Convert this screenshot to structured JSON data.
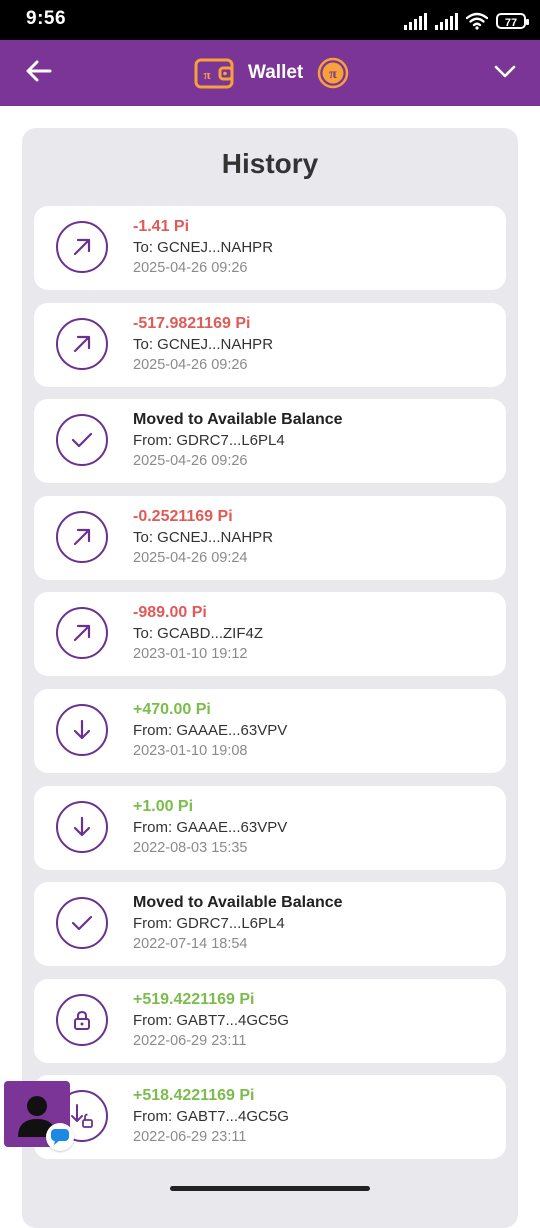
{
  "status_bar": {
    "time": "9:56",
    "battery": "77",
    "icons": [
      "signal-icon",
      "signal-icon",
      "wifi-icon",
      "battery-icon"
    ]
  },
  "header": {
    "title": "Wallet",
    "back_icon": "arrow-left-icon",
    "logo_icon": "wallet-pi-icon",
    "coin_icon": "pi-coin-icon",
    "menu_icon": "chevron-down-icon",
    "color": "#7b3596"
  },
  "history": {
    "title": "History",
    "transactions": [
      {
        "type": "sent",
        "icon": "arrow-up-right-icon",
        "amount": "-1.41 Pi",
        "party": "To: GCNEJ...NAHPR",
        "date": "2025-04-26 09:26"
      },
      {
        "type": "sent",
        "icon": "arrow-up-right-icon",
        "amount": "-517.9821169 Pi",
        "party": "To: GCNEJ...NAHPR",
        "date": "2025-04-26 09:26"
      },
      {
        "type": "moved",
        "icon": "checkmark-icon",
        "amount": "Moved to Available Balance",
        "party": "From: GDRC7...L6PL4",
        "date": "2025-04-26 09:26"
      },
      {
        "type": "sent",
        "icon": "arrow-up-right-icon",
        "amount": "-0.2521169 Pi",
        "party": "To: GCNEJ...NAHPR",
        "date": "2025-04-26 09:24"
      },
      {
        "type": "sent",
        "icon": "arrow-up-right-icon",
        "amount": "-989.00 Pi",
        "party": "To: GCABD...ZIF4Z",
        "date": "2023-01-10 19:12"
      },
      {
        "type": "received",
        "icon": "arrow-down-icon",
        "amount": "+470.00 Pi",
        "party": "From: GAAAE...63VPV",
        "date": "2023-01-10 19:08"
      },
      {
        "type": "received",
        "icon": "arrow-down-icon",
        "amount": "+1.00 Pi",
        "party": "From: GAAAE...63VPV",
        "date": "2022-08-03 15:35"
      },
      {
        "type": "moved",
        "icon": "checkmark-icon",
        "amount": "Moved to Available Balance",
        "party": "From: GDRC7...L6PL4",
        "date": "2022-07-14 18:54"
      },
      {
        "type": "locked",
        "icon": "lock-icon",
        "amount": "+519.4221169 Pi",
        "party": "From: GABT7...4GC5G",
        "date": "2022-06-29 23:11"
      },
      {
        "type": "unlocked",
        "icon": "arrow-down-unlock-icon",
        "amount": "+518.4221169 Pi",
        "party": "From: GABT7...4GC5G",
        "date": "2022-06-29 23:11"
      }
    ]
  },
  "colors": {
    "negative": "#e05a57",
    "positive": "#7bbd4a",
    "icon": "#6a3190",
    "panel": "#e9e8ec"
  },
  "support": {
    "icon": "person-icon",
    "badge_icon": "chat-bubble-icon"
  }
}
